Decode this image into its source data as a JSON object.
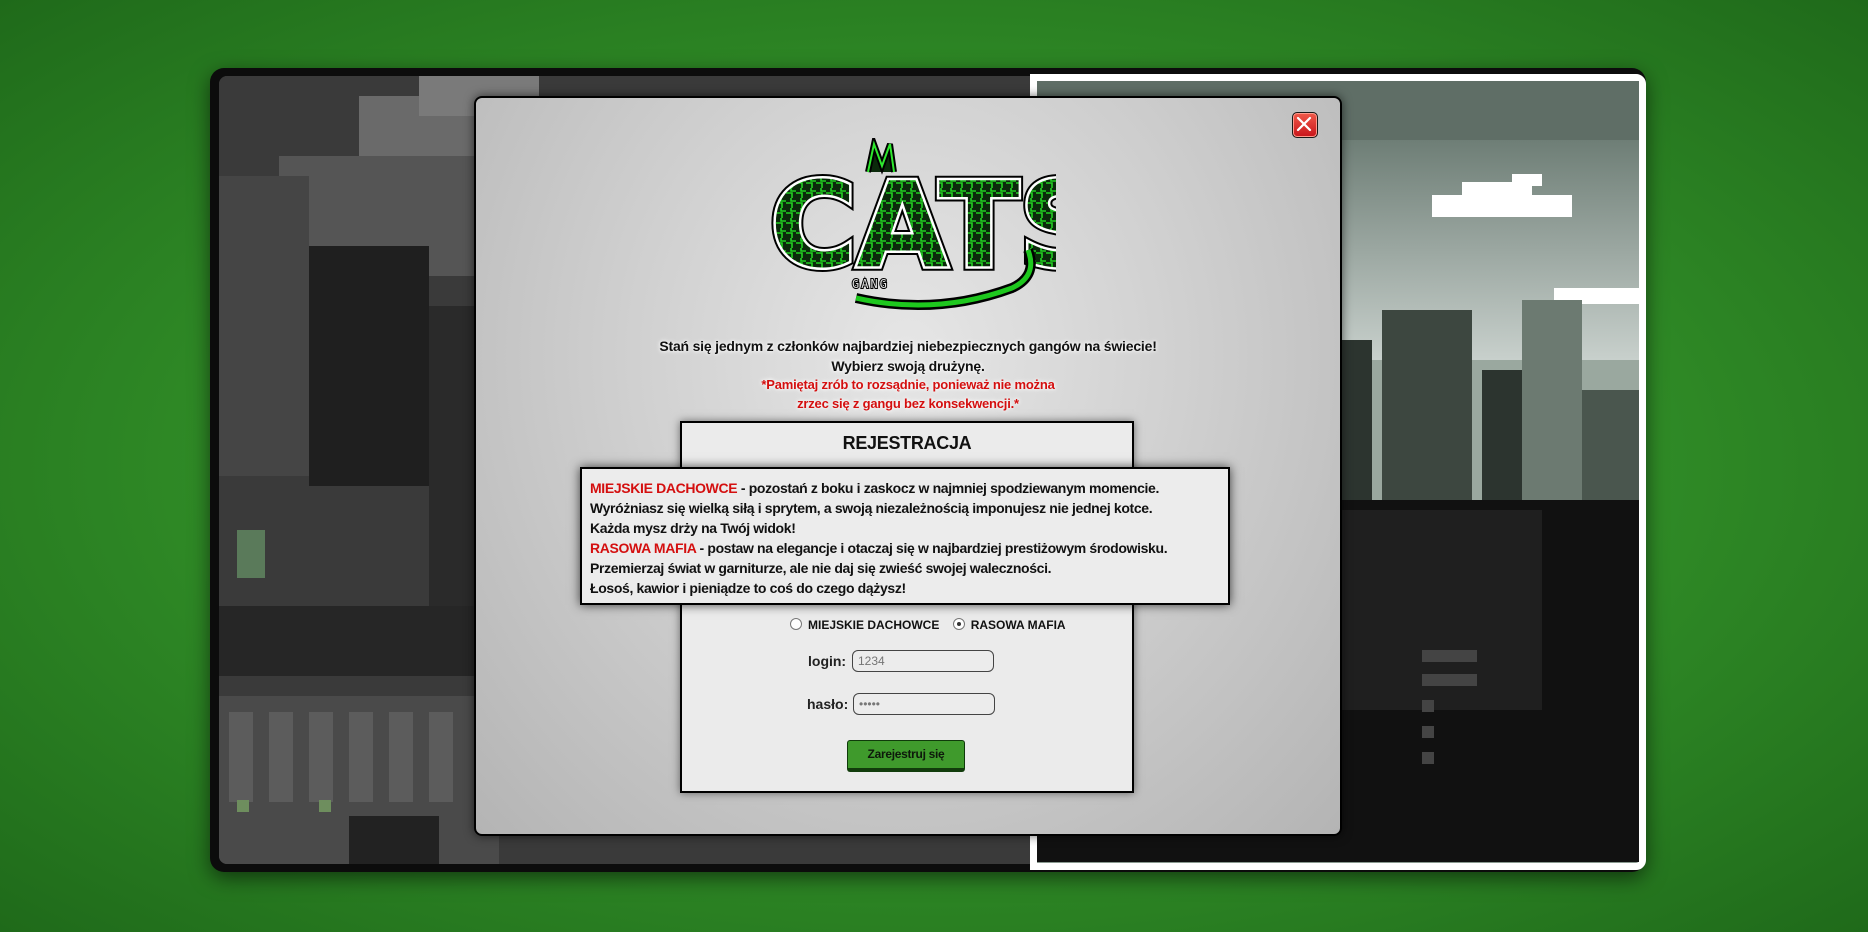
{
  "modal": {
    "close_icon": "close-x-icon",
    "logo": {
      "main": "CATS",
      "sub": "GANG"
    },
    "intro_line1": "Stań się jednym z członków najbardziej niebezpiecznych gangów na świecie!",
    "intro_line2": "Wybierz swoją drużynę.",
    "warning_line1": "*Pamiętaj zrób to rozsądnie, ponieważ nie można",
    "warning_line2": "zrzec się z gangu bez konsekwencji.*"
  },
  "registration": {
    "title": "REJESTRACJA",
    "teams": [
      {
        "label": "MIEJSKIE DACHOWCE",
        "selected": false
      },
      {
        "label": "RASOWA MAFIA",
        "selected": true
      }
    ],
    "login_label": "login:",
    "login_placeholder": "1234",
    "password_label": "hasło:",
    "password_value": "•••••",
    "submit_label": "Zarejestruj się"
  },
  "tooltip": {
    "team1_name": "MIEJSKIE DACHOWCE",
    "team1_line1": " - pozostań z boku i zaskocz w najmniej spodziewanym momencie.",
    "team1_line2": "Wyróżniasz się wielką siłą i sprytem, a swoją niezależnością imponujesz nie jednej kotce.",
    "team1_line3": "Każda mysz drży na Twój widok!",
    "team2_name": "RASOWA MAFIA",
    "team2_line1": " - postaw na elegancje i otaczaj się w najbardziej prestiżowym środowisku.",
    "team2_line2": "Przemierzaj świat w garniturze, ale nie daj się zwieść swojej waleczności.",
    "team2_line3": "Łosoś, kawior i pieniądze to coś do czego dążysz!"
  },
  "colors": {
    "background_green": "#2f8a26",
    "team_highlight": "#d40f0f",
    "button_green": "#3f9a2c",
    "logo_green": "#1ec81e"
  }
}
